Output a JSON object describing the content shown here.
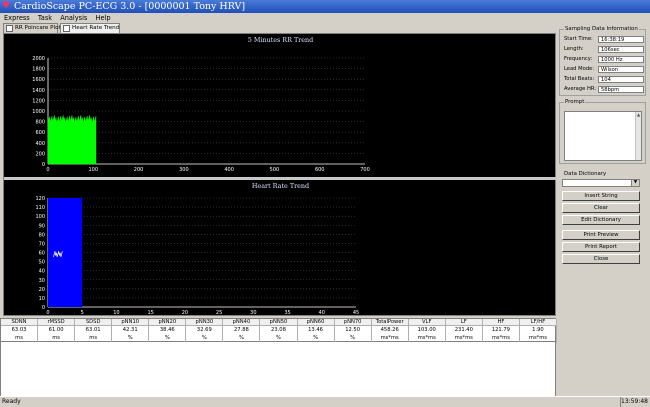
{
  "window": {
    "title": "CardioScape PC-ECG 3.0 - [0000001 Tony HRV]"
  },
  "menu": [
    "Express",
    "Task",
    "Analysis",
    "Help"
  ],
  "tabs": [
    {
      "label": "RR Poincare Plot"
    },
    {
      "label": "Heart Rate Trend"
    }
  ],
  "charts": {
    "rr": {
      "title": "5 Minutes RR Trend",
      "yticks": [
        "0",
        "200",
        "400",
        "600",
        "800",
        "1000",
        "1200",
        "1400",
        "1600",
        "1800",
        "2000"
      ],
      "xticks": [
        "0",
        "100",
        "200",
        "300",
        "400",
        "500",
        "600",
        "700"
      ]
    },
    "hr": {
      "title": "Heart Rate Trend",
      "yticks": [
        "0",
        "10",
        "20",
        "30",
        "40",
        "50",
        "60",
        "70",
        "80",
        "90",
        "100",
        "110",
        "120"
      ],
      "xticks": [
        "0",
        "5",
        "10",
        "15",
        "20",
        "25",
        "30",
        "35",
        "40",
        "45"
      ]
    }
  },
  "chart_data": [
    {
      "type": "area",
      "title": "5 Minutes RR Trend",
      "xlim": [
        0,
        700
      ],
      "ylim": [
        0,
        2000
      ],
      "series": [
        {
          "x": [
            0,
            106
          ],
          "values": [
            850,
            850
          ]
        }
      ],
      "grid": true,
      "color": "#00ff00"
    },
    {
      "type": "bar",
      "title": "Heart Rate Trend",
      "xlim": [
        0,
        45
      ],
      "ylim": [
        0,
        120
      ],
      "series": [
        {
          "x": [
            0,
            5
          ],
          "values": [
            120,
            120
          ]
        }
      ],
      "line_around": 58,
      "grid": true,
      "color": "#0000ff"
    }
  ],
  "table": {
    "columns": [
      {
        "h": "SDNN",
        "v": "63.03",
        "u": "ms"
      },
      {
        "h": "rMSSD",
        "v": "61.00",
        "u": "ms"
      },
      {
        "h": "SDSD",
        "v": "63.01",
        "u": "ms"
      },
      {
        "h": "pNN10",
        "v": "42.31",
        "u": "%"
      },
      {
        "h": "pNN20",
        "v": "38.46",
        "u": "%"
      },
      {
        "h": "pNN30",
        "v": "32.69",
        "u": "%"
      },
      {
        "h": "pNN40",
        "v": "27.88",
        "u": "%"
      },
      {
        "h": "pNN50",
        "v": "23.08",
        "u": "%"
      },
      {
        "h": "pNN60",
        "v": "13.46",
        "u": "%"
      },
      {
        "h": "pNN70",
        "v": "12.50",
        "u": "%"
      },
      {
        "h": "TotalPower",
        "v": "458.26",
        "u": "ms*ms"
      },
      {
        "h": "VLF",
        "v": "103.00",
        "u": "ms*ms"
      },
      {
        "h": "LF",
        "v": "231.40",
        "u": "ms*ms"
      },
      {
        "h": "HF",
        "v": "121.79",
        "u": "ms*ms"
      },
      {
        "h": "LF/HF",
        "v": "1.90",
        "u": "ms*ms"
      }
    ]
  },
  "sampling": {
    "title": "Sampling Data Information",
    "rows": [
      {
        "k": "Start Time:",
        "v": "16:38:19"
      },
      {
        "k": "Length:",
        "v": "106sec"
      },
      {
        "k": "Frequency:",
        "v": "1000 Hz"
      },
      {
        "k": "Lead Mode:",
        "v": "Wilson"
      },
      {
        "k": "Total Beats:",
        "v": "104"
      },
      {
        "k": "Average HR:",
        "v": "58bpm"
      }
    ]
  },
  "prompt": {
    "label": "Prompt"
  },
  "dictionary": {
    "label": "Data Dictionary",
    "selected": "",
    "buttons": [
      "Insert String",
      "Clear",
      "Edit Dictionary"
    ]
  },
  "actions": [
    "Print Preview",
    "Print Report",
    "Close"
  ],
  "status": {
    "text": "Ready",
    "clock": "13:59:48"
  }
}
